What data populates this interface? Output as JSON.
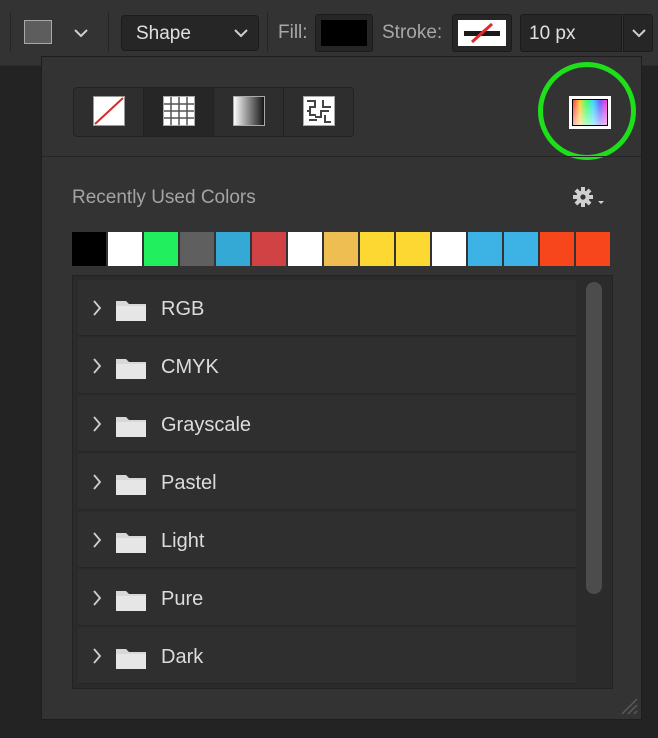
{
  "options_bar": {
    "shape_mode": "Shape",
    "fill_label": "Fill:",
    "stroke_label": "Stroke:",
    "stroke_width": "10 px",
    "fill_color": "#000000"
  },
  "panel": {
    "recent_title": "Recently Used Colors",
    "recent_colors": [
      "#000000",
      "#ffffff",
      "#22ef5e",
      "#5f5f5f",
      "#34a9d6",
      "#d14245",
      "#ffffff",
      "#eebe52",
      "#fdd732",
      "#fdd732",
      "#ffffff",
      "#3cb3e4",
      "#3cb3e4",
      "#f7461c",
      "#f7461c"
    ],
    "highlight_color": "#1ee01a",
    "groups": [
      {
        "name": "RGB"
      },
      {
        "name": "CMYK"
      },
      {
        "name": "Grayscale"
      },
      {
        "name": "Pastel"
      },
      {
        "name": "Light"
      },
      {
        "name": "Pure"
      },
      {
        "name": "Dark"
      }
    ]
  }
}
